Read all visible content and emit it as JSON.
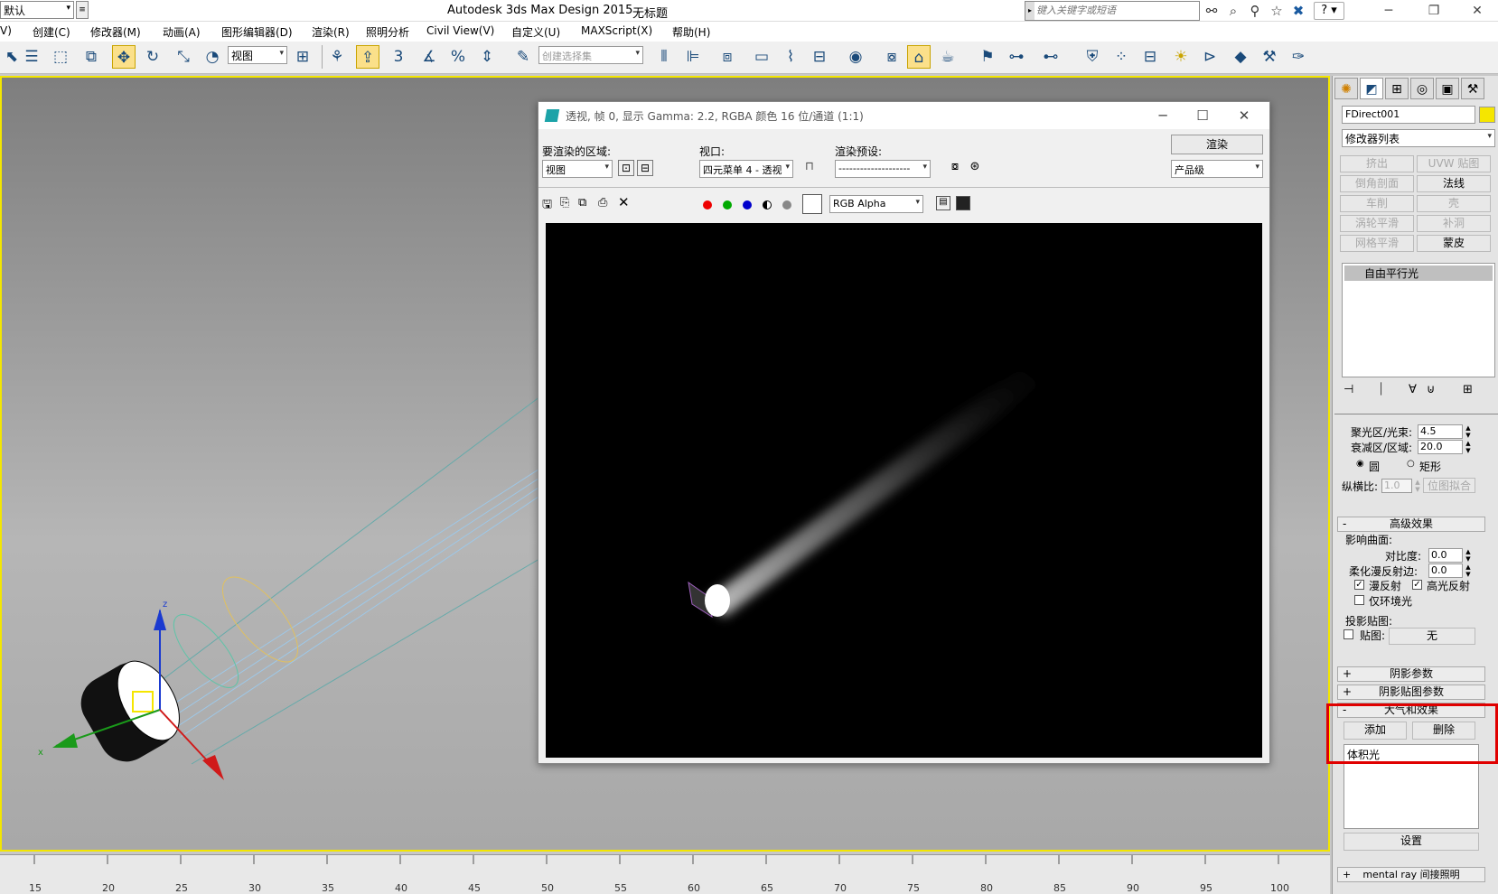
{
  "title_bar": {
    "workspace": "默认",
    "app_title": "Autodesk 3ds Max Design 2015",
    "doc_name": "无标题",
    "search_placeholder": "键入关键字或短语",
    "help_label": "?",
    "icons": [
      "binoculars-icon",
      "search-tools-icon",
      "communication-icon",
      "star-icon",
      "x-icon"
    ]
  },
  "menu": [
    "V)",
    "创建(C)",
    "修改器(M)",
    "动画(A)",
    "图形编辑器(D)",
    "渲染(R)",
    "照明分析",
    "Civil View(V)",
    "自定义(U)",
    "MAXScript(X)",
    "帮助(H)"
  ],
  "toolbar": {
    "view_select": "视图",
    "selection_set_placeholder": "创建选择集",
    "snap_label": "3"
  },
  "render_frame": {
    "title": "透视, 帧 0, 显示 Gamma: 2.2, RGBA 颜色 16 位/通道 (1:1)",
    "area_label": "要渲染的区域:",
    "area_value": "视图",
    "viewport_label": "视口:",
    "viewport_value": "四元菜单 4 - 透视",
    "preset_label": "渲染预设:",
    "preset_value": "--------------------",
    "render_button": "渲染",
    "quality_value": "产品级",
    "channel_value": "RGB Alpha"
  },
  "ruler_ticks": [
    "15",
    "20",
    "25",
    "30",
    "35",
    "40",
    "45",
    "50",
    "55",
    "60",
    "65",
    "70",
    "75",
    "80",
    "85",
    "90",
    "95",
    "100"
  ],
  "command_panel": {
    "object_name": "FDirect001",
    "object_color": "#f5e600",
    "modifier_list": "修改器列表",
    "modifier_buttons": [
      {
        "label": "挤出",
        "enabled": false
      },
      {
        "label": "UVW 贴图",
        "enabled": false
      },
      {
        "label": "倒角剖面",
        "enabled": false
      },
      {
        "label": "法线",
        "enabled": true
      },
      {
        "label": "车削",
        "enabled": false
      },
      {
        "label": "壳",
        "enabled": false
      },
      {
        "label": "涡轮平滑",
        "enabled": false
      },
      {
        "label": "补洞",
        "enabled": false
      },
      {
        "label": "网格平滑",
        "enabled": false
      },
      {
        "label": "蒙皮",
        "enabled": true
      }
    ],
    "stack_item": "自由平行光",
    "hotspot_label": "聚光区/光束:",
    "hotspot_value": "4.5",
    "falloff_label": "衰减区/区域:",
    "falloff_value": "20.0",
    "circle_label": "圆",
    "rect_label": "矩形",
    "aspect_label": "纵横比:",
    "aspect_value": "1.0",
    "bitmap_fit_label": "位图拟合",
    "advanced_effects": "高级效果",
    "affect_surfaces": "影响曲面:",
    "contrast_label": "对比度:",
    "contrast_value": "0.0",
    "soften_label": "柔化漫反射边:",
    "soften_value": "0.0",
    "diffuse_label": "漫反射",
    "specular_label": "高光反射",
    "ambient_label": "仅环境光",
    "projector_label": "投影贴图:",
    "map_label": "贴图:",
    "map_button": "无",
    "shadow_params": "阴影参数",
    "shadow_map_params": "阴影贴图参数",
    "atmos_effects": "大气和效果",
    "add_button": "添加",
    "delete_button": "删除",
    "atmos_item": "体积光",
    "setup_button": "设置",
    "mental_ray": "mental ray 间接照明",
    "plus": "+",
    "minus": "-"
  }
}
